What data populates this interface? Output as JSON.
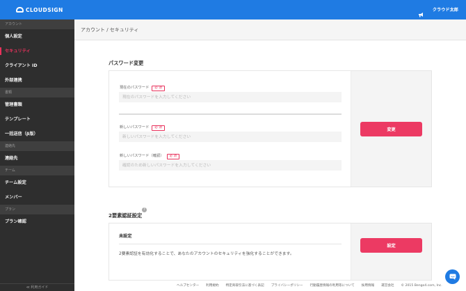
{
  "brand": {
    "logo_text": "CLOUDSIGN"
  },
  "header": {
    "user_name": "クラウド太郎"
  },
  "sidebar": {
    "sections": [
      {
        "title": "アカウント",
        "items": [
          {
            "label": "個人設定",
            "active": false
          },
          {
            "label": "セキュリティ",
            "active": true
          },
          {
            "label": "クライアント ID",
            "active": false
          },
          {
            "label": "外部連携",
            "active": false
          }
        ]
      },
      {
        "title": "書類",
        "items": [
          {
            "label": "管理書類",
            "active": false
          },
          {
            "label": "テンプレート",
            "active": false
          },
          {
            "label": "一括送信（β版）",
            "active": false
          }
        ]
      },
      {
        "title": "連絡先",
        "items": [
          {
            "label": "連絡先",
            "active": false
          }
        ]
      },
      {
        "title": "チーム",
        "items": [
          {
            "label": "チーム設定",
            "active": false
          },
          {
            "label": "メンバー",
            "active": false
          }
        ]
      },
      {
        "title": "プラン",
        "items": [
          {
            "label": "プラン確認",
            "active": false
          }
        ]
      }
    ],
    "footer_label": "≪ 利用ガイド"
  },
  "breadcrumb": "アカウント / セキュリティ",
  "password_section": {
    "title": "パスワード変更",
    "required_badge": "必 須",
    "current_label": "現在のパスワード",
    "current_placeholder": "現在のパスワードを入力してください",
    "new_label": "新しいパスワード",
    "new_placeholder": "新しいパスワードを入力してください",
    "confirm_label": "新しいパスワード（確認）",
    "confirm_placeholder": "確認のため新しいパスワードを入力してください",
    "submit_label": "変更"
  },
  "twofa_section": {
    "title": "2要素認証設定",
    "help_icon": "?",
    "status": "未設定",
    "description": "2要素認証を有効化することで、あなたのアカウントのセキュリティを強化することができます。",
    "button_label": "設定"
  },
  "footer": {
    "links": [
      "ヘルプセンター",
      "利用規約",
      "特定商取引法に基づく表記",
      "プライバシーポリシー",
      "行動履歴情報の利用等について",
      "採用情報",
      "運営会社"
    ],
    "copyright": "© 2015 Bengo4.com, Inc."
  },
  "colors": {
    "accent": "#1f7be3",
    "primary_button": "#ec3a63",
    "sidebar_bg": "#2e2e2e"
  }
}
